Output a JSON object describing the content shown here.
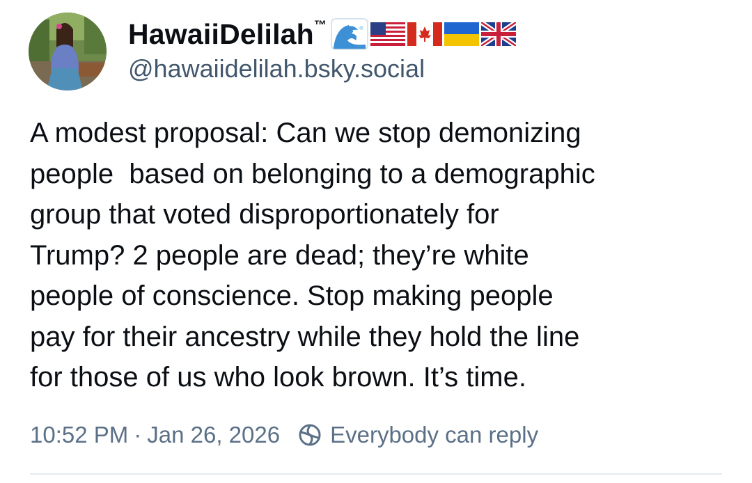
{
  "author": {
    "display_name": "HawaiiDelilah",
    "trademark": "™",
    "handle": "@hawaiidelilah.bsky.social",
    "avatar": "avatar-photo",
    "name_emojis": [
      "water-wave-icon",
      "us-flag-icon",
      "canada-flag-icon",
      "ukraine-flag-icon",
      "uk-flag-icon"
    ]
  },
  "post": {
    "text": "A modest proposal: Can we stop demonizing\npeople  based on belonging to a demographic\ngroup that voted disproportionately for\nTrump? 2 people are dead; they’re white\npeople of conscience. Stop making people\npay for their ancestry while they hold the line\nfor those of us who look brown. It’s time.",
    "time": "10:52 PM",
    "separator": "·",
    "date": "Jan 26, 2026",
    "reply_setting": "Everybody can reply",
    "reply_icon": "everybody-can-reply-icon"
  },
  "colors": {
    "text": "#0b0f14",
    "muted": "#5b7086",
    "handle": "#42576c",
    "divider": "#e6eaee"
  }
}
